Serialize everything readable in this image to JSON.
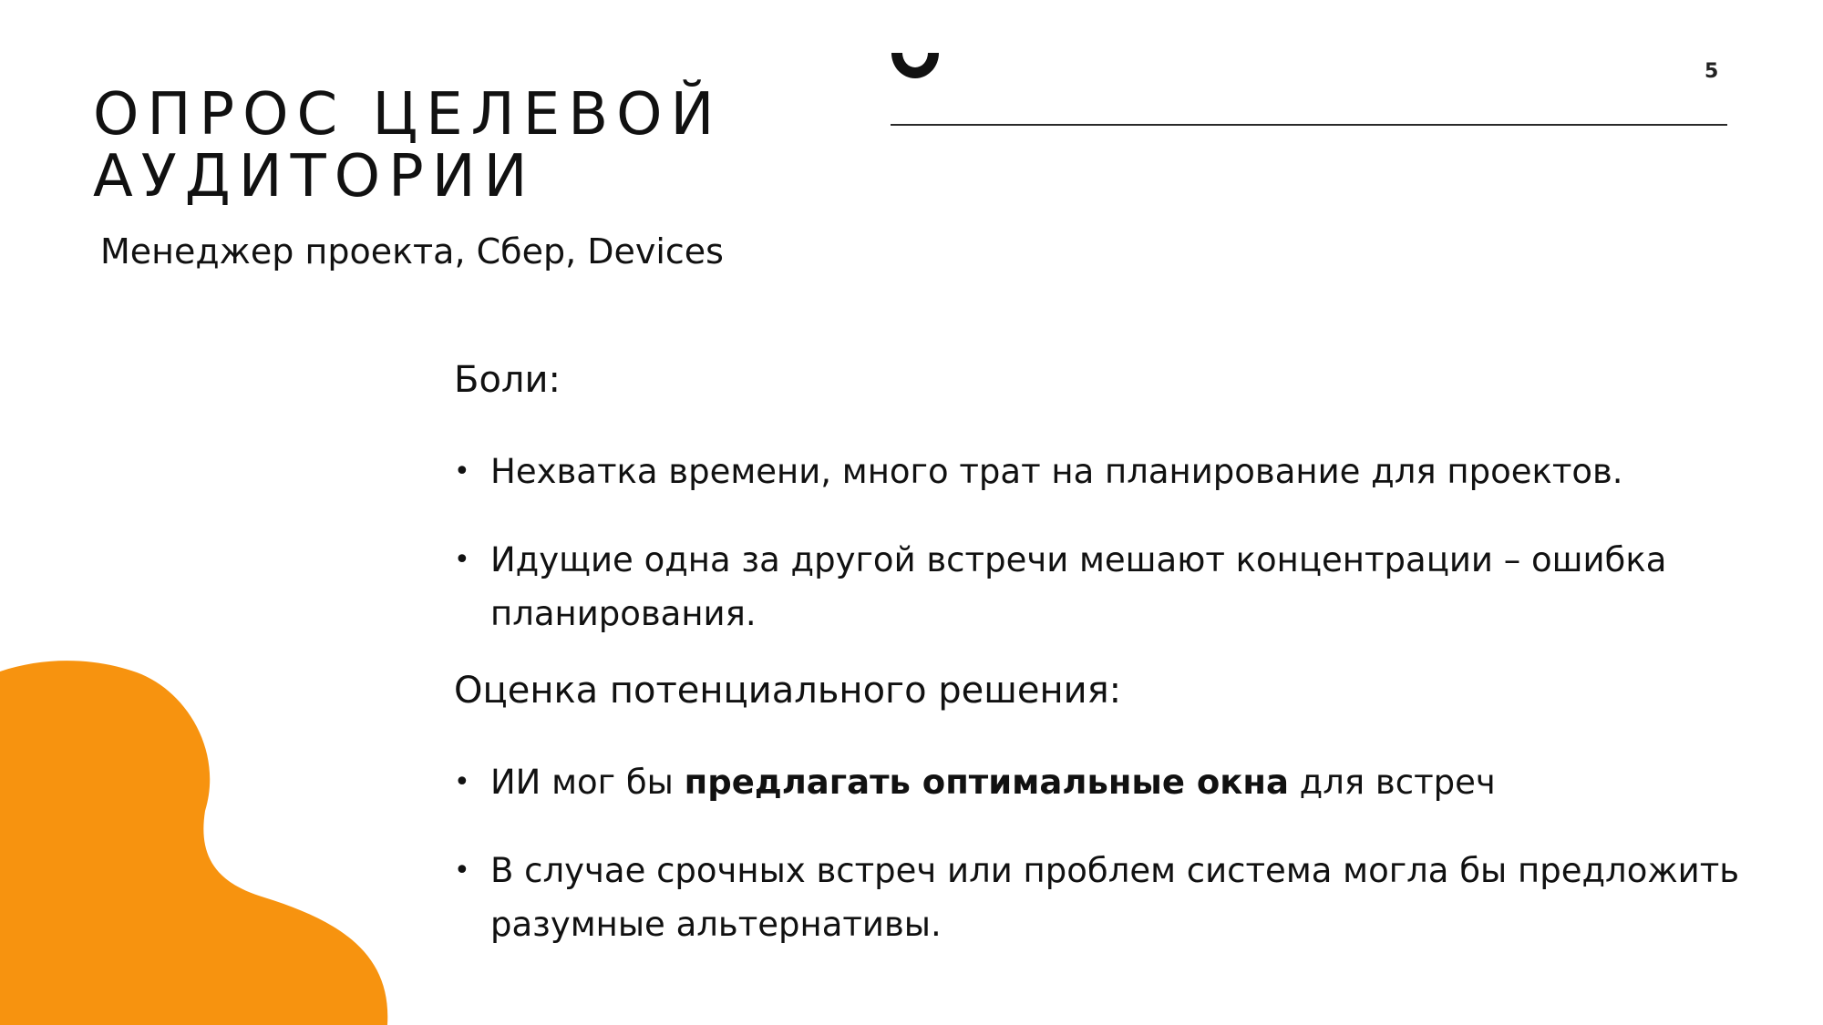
{
  "slide": {
    "page_number": "5",
    "title_line1": "ОПРОС ЦЕЛЕВОЙ",
    "title_line2": "АУДИТОРИИ",
    "subtitle": "Менеджер проекта, Сбер, Devices"
  },
  "pains": {
    "heading": "Боли:",
    "items": [
      {
        "text": "Нехватка времени, много трат на планирование для проектов."
      },
      {
        "text": "Идущие одна за другой встречи мешают концентрации – ошибка планирования."
      }
    ]
  },
  "solution": {
    "heading": "Оценка потенциального решения:",
    "items": [
      {
        "before": "ИИ мог бы ",
        "bold": "предлагать оптимальные окна",
        "after": " для встреч"
      },
      {
        "text": "В случае срочных встреч или проблем система могла бы предложить разумные альтернативы."
      }
    ]
  },
  "bullet_symbol": "•",
  "colors": {
    "accent_orange": "#F7930F",
    "text": "#111111",
    "background": "#FFFFFF",
    "arc": "#111111"
  },
  "icons": {
    "decoration_top": "half-ring-arc",
    "decoration_bottom_left": "orange-blob"
  }
}
